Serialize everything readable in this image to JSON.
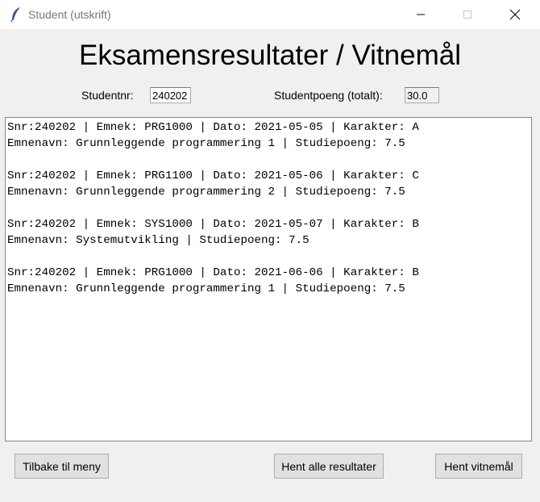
{
  "window": {
    "title": "Student (utskrift)",
    "icon": "feather-icon"
  },
  "heading": "Eksamensresultater / Vitnemål",
  "form": {
    "student_nr_label": "Studentnr:",
    "student_nr_value": "240202",
    "points_label": "Studentpoeng (totalt):",
    "points_value": "30.0"
  },
  "results": [
    {
      "line1": "Snr:240202 | Emnek: PRG1000 | Dato: 2021-05-05 | Karakter: A",
      "line2": "Emnenavn: Grunnleggende programmering 1 | Studiepoeng: 7.5"
    },
    {
      "line1": "Snr:240202 | Emnek: PRG1100 | Dato: 2021-05-06 | Karakter: C",
      "line2": "Emnenavn: Grunnleggende programmering 2 | Studiepoeng: 7.5"
    },
    {
      "line1": "Snr:240202 | Emnek: SYS1000 | Dato: 2021-05-07 | Karakter: B",
      "line2": "Emnenavn: Systemutvikling | Studiepoeng: 7.5"
    },
    {
      "line1": "Snr:240202 | Emnek: PRG1000 | Dato: 2021-06-06 | Karakter: B",
      "line2": "Emnenavn: Grunnleggende programmering 1 | Studiepoeng: 7.5"
    }
  ],
  "buttons": {
    "back": "Tilbake til meny",
    "all_results": "Hent alle resultater",
    "diploma": "Hent vitnemål"
  }
}
